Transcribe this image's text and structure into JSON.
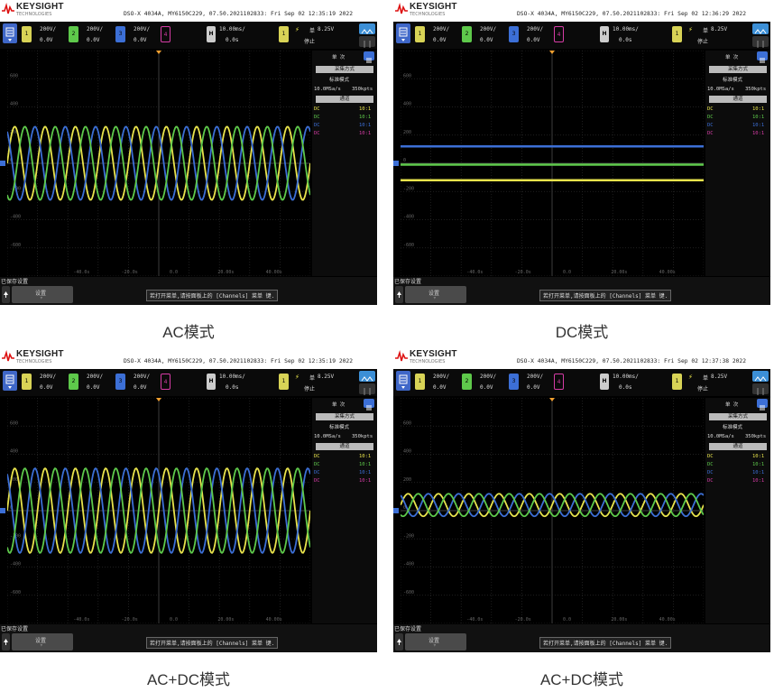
{
  "panels": [
    {
      "brand": "KEYSIGHT",
      "brand_sub": "TECHNOLOGIES",
      "header": "DSO-X 4034A, MY6150C229, 07.50.2021102833: Fri Sep 02 12:35:19 2022",
      "ch1": {
        "num": "1",
        "scale": "200V/",
        "offset": "0.0V"
      },
      "ch2": {
        "num": "2",
        "scale": "200V/",
        "offset": "0.0V"
      },
      "ch3": {
        "num": "3",
        "scale": "200V/",
        "offset": "0.0V"
      },
      "ch4": {
        "num": "4"
      },
      "horiz": {
        "label": "H",
        "scale": "10.00ms/",
        "delay": "0.0s"
      },
      "trig": {
        "num": "1",
        "mode": "单",
        "level": "8.25V",
        "status": "停止"
      },
      "right": {
        "title": "单 次",
        "acq_btn": "采集方式",
        "acq_mode": "标准模式",
        "rate": "10.0MSa/s",
        "memory": "350kpts",
        "probe_btn": "通道",
        "probes": [
          {
            "coupling": "DC",
            "ratio": "10:1",
            "color": "#e8e34c"
          },
          {
            "coupling": "DC",
            "ratio": "10:1",
            "color": "#5ec94b"
          },
          {
            "coupling": "DC",
            "ratio": "10:1",
            "color": "#3c6fd6"
          },
          {
            "coupling": "DC",
            "ratio": "10:1",
            "color": "#d63ca6"
          }
        ]
      },
      "status": "已保存设置",
      "softkey": "设置",
      "message": "若打开菜单,请按面板上的 [Channels] 菜单 键.",
      "caption": "AC模式",
      "waveform": {
        "mode": "AC",
        "amplitude_div": 1.3,
        "offsets_div": {
          "yellow": 0,
          "green": 0,
          "blue": 0
        },
        "cycles": 10
      }
    },
    {
      "brand": "KEYSIGHT",
      "brand_sub": "TECHNOLOGIES",
      "header": "DSO-X 4034A, MY6150C229, 07.50.2021102833: Fri Sep 02 12:36:29 2022",
      "ch1": {
        "num": "1",
        "scale": "200V/",
        "offset": "0.0V"
      },
      "ch2": {
        "num": "2",
        "scale": "200V/",
        "offset": "0.0V"
      },
      "ch3": {
        "num": "3",
        "scale": "200V/",
        "offset": "0.0V"
      },
      "ch4": {
        "num": "4"
      },
      "horiz": {
        "label": "H",
        "scale": "10.00ms/",
        "delay": "0.0s"
      },
      "trig": {
        "num": "1",
        "mode": "单",
        "level": "8.25V",
        "status": "停止"
      },
      "right": {
        "title": "单 次",
        "acq_btn": "采集方式",
        "acq_mode": "标准模式",
        "rate": "10.0MSa/s",
        "memory": "350kpts",
        "probe_btn": "通道",
        "probes": [
          {
            "coupling": "DC",
            "ratio": "10:1",
            "color": "#e8e34c"
          },
          {
            "coupling": "DC",
            "ratio": "10:1",
            "color": "#5ec94b"
          },
          {
            "coupling": "DC",
            "ratio": "10:1",
            "color": "#3c6fd6"
          },
          {
            "coupling": "DC",
            "ratio": "10:1",
            "color": "#d63ca6"
          }
        ]
      },
      "status": "已保存设置",
      "softkey": "设置",
      "message": "若打开菜单,请按面板上的 [Channels] 菜单 键.",
      "caption": "DC模式",
      "waveform": {
        "mode": "DC",
        "amplitude_div": 0,
        "offsets_div": {
          "yellow": -0.6,
          "green": -0.05,
          "blue": 0.6
        },
        "cycles": 0
      }
    },
    {
      "brand": "KEYSIGHT",
      "brand_sub": "TECHNOLOGIES",
      "header": "DSO-X 4034A, MY6150C229, 07.50.2021102833: Fri Sep 02 12:35:19 2022",
      "ch1": {
        "num": "1",
        "scale": "200V/",
        "offset": "0.0V"
      },
      "ch2": {
        "num": "2",
        "scale": "200V/",
        "offset": "0.0V"
      },
      "ch3": {
        "num": "3",
        "scale": "200V/",
        "offset": "0.0V"
      },
      "ch4": {
        "num": "4"
      },
      "horiz": {
        "label": "H",
        "scale": "10.00ms/",
        "delay": "0.0s"
      },
      "trig": {
        "num": "1",
        "mode": "单",
        "level": "8.25V",
        "status": "停止"
      },
      "right": {
        "title": "单 次",
        "acq_btn": "采集方式",
        "acq_mode": "标准模式",
        "rate": "10.0MSa/s",
        "memory": "350kpts",
        "probe_btn": "通道",
        "probes": [
          {
            "coupling": "DC",
            "ratio": "10:1",
            "color": "#e8e34c"
          },
          {
            "coupling": "DC",
            "ratio": "10:1",
            "color": "#5ec94b"
          },
          {
            "coupling": "DC",
            "ratio": "10:1",
            "color": "#3c6fd6"
          },
          {
            "coupling": "DC",
            "ratio": "10:1",
            "color": "#d63ca6"
          }
        ]
      },
      "status": "已保存设置",
      "softkey": "设置",
      "message": "若打开菜单,请按面板上的 [Channels] 菜单 键.",
      "caption": "AC+DC模式",
      "waveform": {
        "mode": "AC+DC",
        "amplitude_div": 1.5,
        "offsets_div": {
          "yellow": 0,
          "green": 0,
          "blue": 0
        },
        "cycles": 10
      }
    },
    {
      "brand": "KEYSIGHT",
      "brand_sub": "TECHNOLOGIES",
      "header": "DSO-X 4034A, MY6150C229, 07.50.2021102833: Fri Sep 02 12:37:38 2022",
      "ch1": {
        "num": "1",
        "scale": "200V/",
        "offset": "0.0V"
      },
      "ch2": {
        "num": "2",
        "scale": "200V/",
        "offset": "0.0V"
      },
      "ch3": {
        "num": "3",
        "scale": "200V/",
        "offset": "0.0V"
      },
      "ch4": {
        "num": "4"
      },
      "horiz": {
        "label": "H",
        "scale": "10.00ms/",
        "delay": "0.0s"
      },
      "trig": {
        "num": "1",
        "mode": "单",
        "level": "8.25V",
        "status": "停止"
      },
      "right": {
        "title": "单 次",
        "acq_btn": "采集方式",
        "acq_mode": "标准模式",
        "rate": "10.0MSa/s",
        "memory": "350kpts",
        "probe_btn": "通道",
        "probes": [
          {
            "coupling": "DC",
            "ratio": "10:1",
            "color": "#e8e34c"
          },
          {
            "coupling": "DC",
            "ratio": "10:1",
            "color": "#5ec94b"
          },
          {
            "coupling": "DC",
            "ratio": "10:1",
            "color": "#3c6fd6"
          },
          {
            "coupling": "DC",
            "ratio": "10:1",
            "color": "#d63ca6"
          }
        ]
      },
      "status": "已保存设置",
      "softkey": "设置",
      "message": "若打开菜单,请按面板上的 [Channels] 菜单 键.",
      "caption": "AC+DC模式",
      "waveform": {
        "mode": "AC+DC",
        "amplitude_div": 0.4,
        "offsets_div": {
          "yellow": 0.2,
          "green": 0.2,
          "blue": 0.2
        },
        "cycles": 10
      }
    }
  ],
  "colors": {
    "ch1": "#e8e34c",
    "ch2": "#5ec94b",
    "ch3": "#3c6fd6",
    "ch4": "#d63ca6",
    "trigger": "#f0a030"
  },
  "ticks": {
    "x": [
      "-40.0s",
      "-20.0s",
      "0.0",
      "20.00s",
      "40.00s"
    ],
    "y": [
      "600",
      "400",
      "200",
      "0",
      "-200",
      "-400",
      "-600"
    ]
  }
}
